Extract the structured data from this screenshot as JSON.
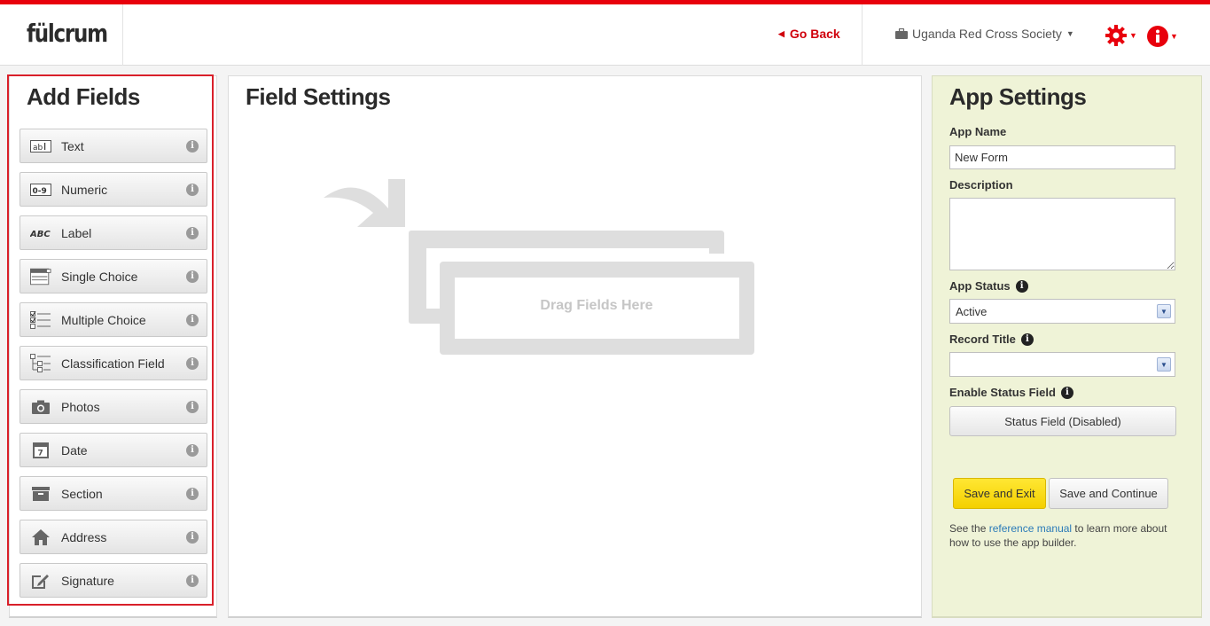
{
  "header": {
    "logo": "fülcrum",
    "go_back": "Go Back",
    "organization": "Uganda Red Cross Society",
    "settings_icon": "gear-icon",
    "info_icon": "info-icon",
    "accent_color": "#e8000c"
  },
  "add_fields": {
    "title": "Add Fields",
    "items": [
      {
        "label": "Text",
        "icon": "text-field-icon"
      },
      {
        "label": "Numeric",
        "icon": "numeric-field-icon"
      },
      {
        "label": "Label",
        "icon": "label-field-icon"
      },
      {
        "label": "Single Choice",
        "icon": "single-choice-icon"
      },
      {
        "label": "Multiple Choice",
        "icon": "multiple-choice-icon"
      },
      {
        "label": "Classification Field",
        "icon": "classification-icon"
      },
      {
        "label": "Photos",
        "icon": "camera-icon"
      },
      {
        "label": "Date",
        "icon": "calendar-icon"
      },
      {
        "label": "Section",
        "icon": "section-box-icon"
      },
      {
        "label": "Address",
        "icon": "house-icon"
      },
      {
        "label": "Signature",
        "icon": "signature-pen-icon"
      }
    ]
  },
  "field_settings": {
    "title": "Field Settings",
    "drop_label": "Drag Fields Here"
  },
  "app_settings": {
    "title": "App Settings",
    "app_name_label": "App Name",
    "app_name_value": "New Form",
    "description_label": "Description",
    "description_value": "",
    "app_status_label": "App Status",
    "app_status_value": "Active",
    "record_title_label": "Record Title",
    "record_title_value": "",
    "enable_status_label": "Enable Status Field",
    "status_button": "Status Field (Disabled)",
    "save_exit": "Save and Exit",
    "save_continue": "Save and Continue",
    "help_prefix": "See the ",
    "help_link": "reference manual",
    "help_suffix": " to learn more about how to use the app builder."
  }
}
